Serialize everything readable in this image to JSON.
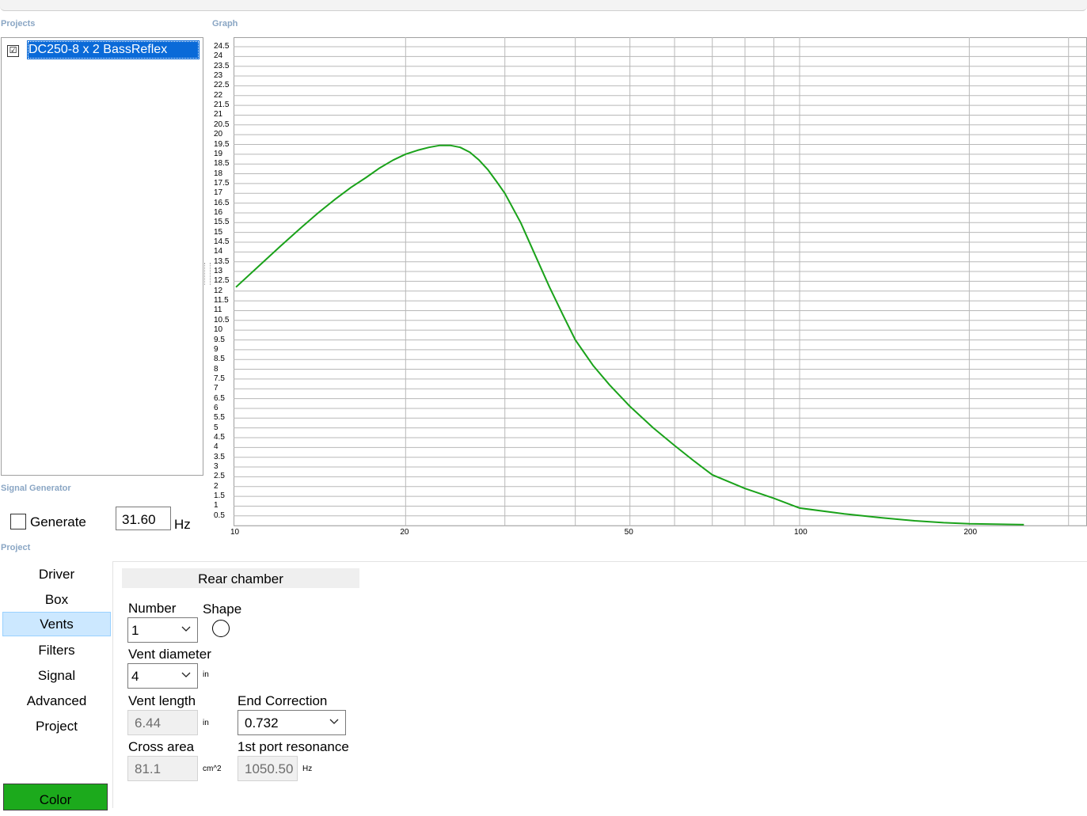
{
  "sections": {
    "projects": "Projects",
    "graph": "Graph",
    "signal_generator": "Signal Generator",
    "project": "Project"
  },
  "projects": {
    "items": [
      {
        "label": "DC250-8 x 2 BassReflex",
        "checked": true,
        "check_glyph": "☑"
      }
    ]
  },
  "signal_generator": {
    "generate_label": "Generate",
    "generate_checked": false,
    "frequency": "31.60",
    "unit": "Hz"
  },
  "graph": {
    "line_color": "#1aa21a",
    "grid_color": "#b8b8b8",
    "y_ticks": [
      "24.5",
      "24",
      "23.5",
      "23",
      "22.5",
      "22",
      "21.5",
      "21",
      "20.5",
      "20",
      "19.5",
      "19",
      "18.5",
      "18",
      "17.5",
      "17",
      "16.5",
      "16",
      "15.5",
      "15",
      "14.5",
      "14",
      "13.5",
      "13",
      "12.5",
      "12",
      "11.5",
      "11",
      "10.5",
      "10",
      "9.5",
      "9",
      "8.5",
      "8",
      "7.5",
      "7",
      "6.5",
      "6",
      "5.5",
      "5",
      "4.5",
      "4",
      "3.5",
      "3",
      "2.5",
      "2",
      "1.5",
      "1",
      "0.5"
    ],
    "x_tick_labels": [
      "10",
      "20",
      "50",
      "100",
      "200"
    ]
  },
  "chart_data": {
    "type": "line",
    "xscale": "log",
    "xlim": [
      10,
      250
    ],
    "ylim": [
      0,
      25
    ],
    "grid": true,
    "series": [
      {
        "color": "#1aa21a",
        "x": [
          10,
          11,
          12,
          13,
          14,
          15,
          16,
          17,
          18,
          19,
          20,
          21,
          22,
          23,
          24,
          25,
          26,
          27,
          28,
          29,
          30,
          32,
          34,
          36,
          38,
          40,
          43,
          46,
          50,
          55,
          60,
          65,
          70,
          80,
          90,
          100,
          120,
          140,
          160,
          180,
          200,
          250
        ],
        "y": [
          12.2,
          13.3,
          14.3,
          15.2,
          16.0,
          16.7,
          17.3,
          17.8,
          18.3,
          18.7,
          19.0,
          19.2,
          19.35,
          19.45,
          19.45,
          19.35,
          19.1,
          18.7,
          18.2,
          17.6,
          17.0,
          15.5,
          13.8,
          12.2,
          10.8,
          9.5,
          8.2,
          7.2,
          6.1,
          5.0,
          4.1,
          3.3,
          2.6,
          1.9,
          1.4,
          0.9,
          0.6,
          0.4,
          0.25,
          0.15,
          0.1,
          0.05
        ]
      }
    ]
  },
  "nav": {
    "items": [
      "Driver",
      "Box",
      "Vents",
      "Filters",
      "Signal",
      "Advanced",
      "Project"
    ],
    "active": "Vents",
    "color_button": "Color",
    "color_button_color": "#1caa1c"
  },
  "rear_chamber": {
    "header": "Rear chamber",
    "number_label": "Number",
    "number_value": "1",
    "shape_label": "Shape",
    "shape_icon": "circle-icon",
    "vent_diameter_label": "Vent diameter",
    "vent_diameter_value": "4",
    "vent_diameter_unit": "in",
    "vent_length_label": "Vent length",
    "vent_length_value": "6.44",
    "vent_length_unit": "in",
    "end_correction_label": "End Correction",
    "end_correction_value": "0.732",
    "cross_area_label": "Cross area",
    "cross_area_value": "81.1",
    "cross_area_unit": "cm^2",
    "port_resonance_label": "1st port resonance",
    "port_resonance_value": "1050.50",
    "port_resonance_unit": "Hz"
  }
}
